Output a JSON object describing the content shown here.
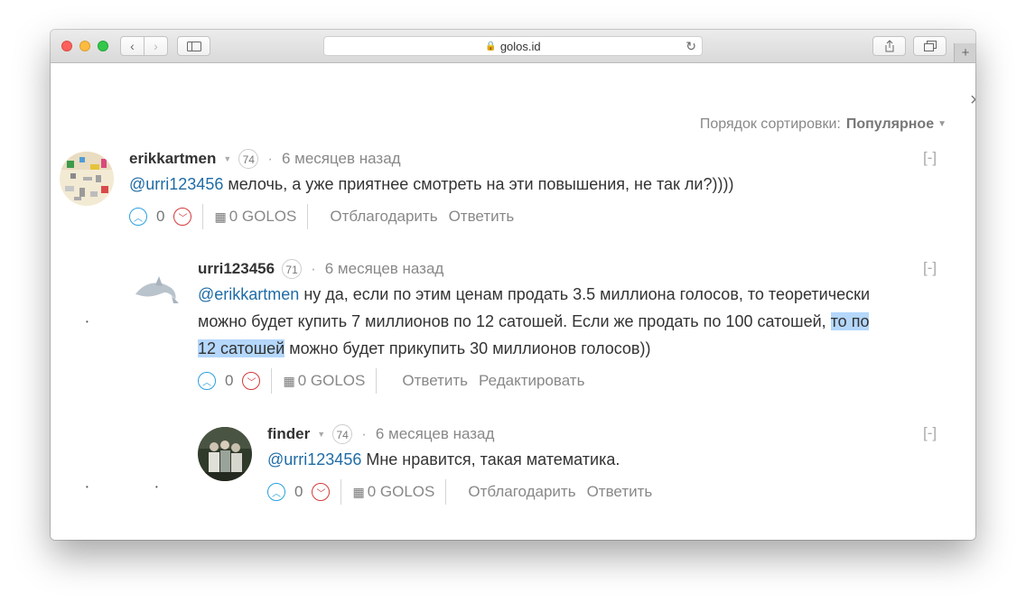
{
  "browser": {
    "url": "golos.id",
    "lock_icon": "lock-icon",
    "new_tab": "+"
  },
  "sort": {
    "label": "Порядок сортировки:",
    "value": "Популярное"
  },
  "comments": [
    {
      "author": "erikkartmen",
      "reputation": "74",
      "time": "6 месяцев назад",
      "collapse": "[-]",
      "mention": "@urri123456",
      "text": " мелочь, а уже приятнее смотреть на эти повышения, не так ли?))))",
      "votes": "0",
      "payout": "0 GOLOS",
      "actions": [
        "Отблагодарить",
        "Ответить"
      ]
    },
    {
      "author": "urri123456",
      "reputation": "71",
      "time": "6 месяцев назад",
      "collapse": "[-]",
      "mention": "@erikkartmen",
      "text_line1": " ну да, если по этим ценам продать 3.5 миллиона голосов, то теоретически",
      "text_line2_a": "можно будет купить 7 миллионов по 12 сатошей. Если же продать по 100 сатошей, ",
      "text_line2_hl": "то по",
      "text_line3_hl": "12 сатошей",
      "text_line3_b": " можно будет прикупить 30 миллионов голосов))",
      "votes": "0",
      "payout": "0 GOLOS",
      "actions": [
        "Ответить",
        "Редактировать"
      ]
    },
    {
      "author": "finder",
      "reputation": "74",
      "time": "6 месяцев назад",
      "collapse": "[-]",
      "mention": "@urri123456",
      "text": " Мне нравится, такая математика.",
      "votes": "0",
      "payout": "0 GOLOS",
      "actions": [
        "Отблагодарить",
        "Ответить"
      ]
    }
  ]
}
